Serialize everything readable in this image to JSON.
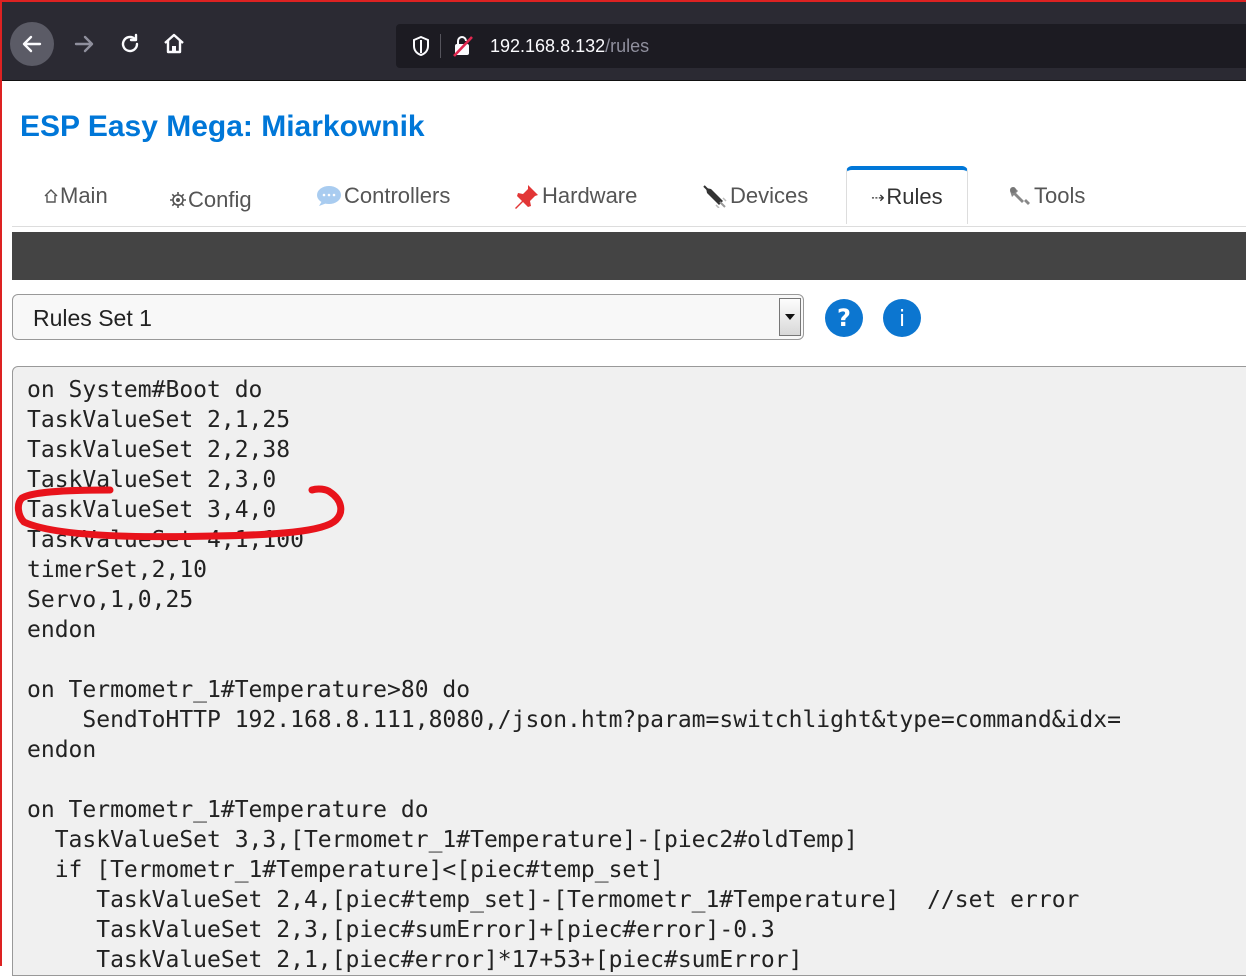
{
  "browser": {
    "url_host": "192.168.8.132",
    "url_path": "/rules"
  },
  "page": {
    "title": "ESP Easy Mega: Miarkownik"
  },
  "tabs": [
    {
      "label": "Main",
      "icon": "home-outline-icon"
    },
    {
      "label": "Config",
      "icon": "gear-icon"
    },
    {
      "label": "Controllers",
      "icon": "speech-bubble-icon"
    },
    {
      "label": "Hardware",
      "icon": "pushpin-icon"
    },
    {
      "label": "Devices",
      "icon": "plug-icon"
    },
    {
      "label": "Rules",
      "icon": "arrow-icon",
      "glyph": "⇢"
    },
    {
      "label": "Tools",
      "icon": "wrench-icon"
    }
  ],
  "active_tab": "Rules",
  "rules": {
    "selected_set": "Rules Set 1",
    "help_icon": "question-icon",
    "info_icon": "info-icon",
    "lines": [
      "on System#Boot do",
      "TaskValueSet 2,1,25",
      "TaskValueSet 2,2,38",
      "TaskValueSet 2,3,0",
      "TaskValueSet 3,4,0",
      "TaskValueSet 4,1,100",
      "timerSet,2,10",
      "Servo,1,0,25",
      "endon",
      "",
      "on Termometr_1#Temperature>80 do",
      "    SendToHTTP 192.168.8.111,8080,/json.htm?param=switchlight&type=command&idx=",
      "endon",
      "",
      "on Termometr_1#Temperature do",
      "  TaskValueSet 3,3,[Termometr_1#Temperature]-[piec2#oldTemp]",
      "  if [Termometr_1#Temperature]<[piec#temp_set]",
      "     TaskValueSet 2,4,[piec#temp_set]-[Termometr_1#Temperature]  //set error",
      "     TaskValueSet 2,3,[piec#sumError]+[piec#error]-0.3",
      "     TaskValueSet 2,1,[piec#error]*17+53+[piec#sumError]"
    ]
  },
  "colors": {
    "title": "#0077d8",
    "annotation": "#e8131b",
    "browser_bar": "#2b2a33"
  }
}
